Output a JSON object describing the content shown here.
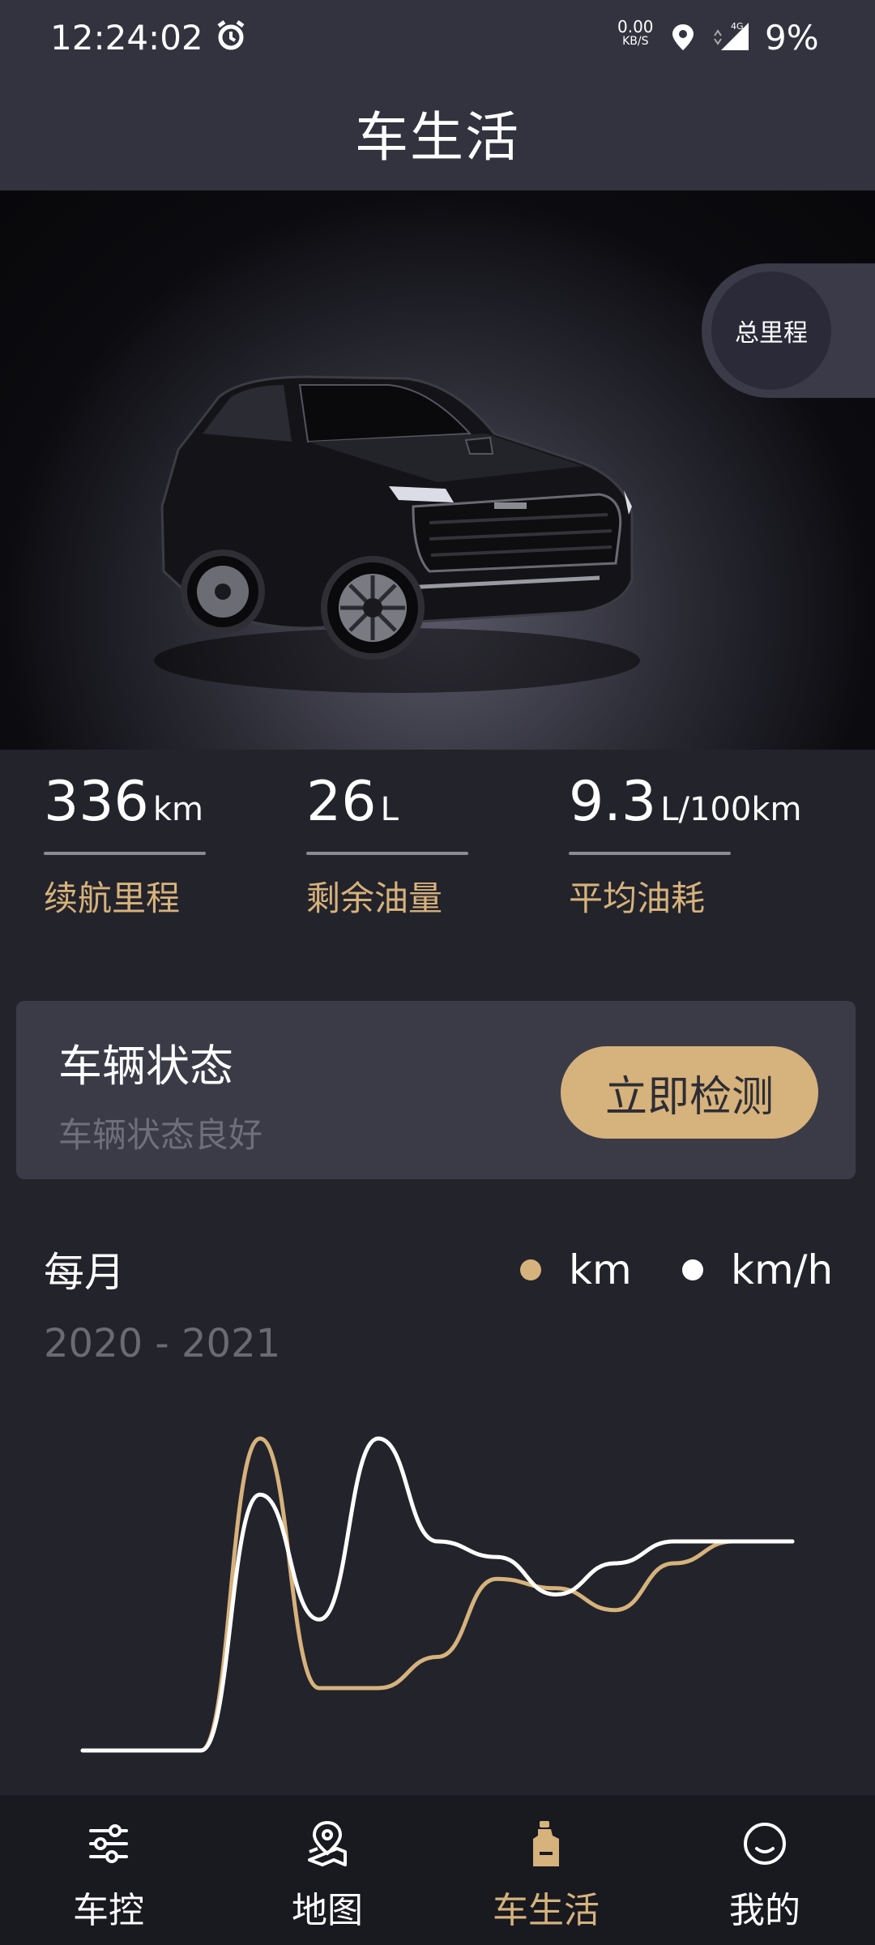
{
  "status_bar": {
    "time": "12:24:02",
    "net_speed": "0.00",
    "net_unit": "KB/S",
    "network_type": "4G",
    "battery": "9%"
  },
  "app_bar": {
    "title": "车生活"
  },
  "hero": {
    "mileage_button_label": "总里程"
  },
  "stats": [
    {
      "value": "336",
      "unit": "km",
      "label": "续航里程"
    },
    {
      "value": "26",
      "unit": "L",
      "label": "剩余油量"
    },
    {
      "value": "9.3",
      "unit": "L/100km",
      "label": "平均油耗"
    }
  ],
  "vehicle_status": {
    "title": "车辆状态",
    "subtitle": "车辆状态良好",
    "button_label": "立即检测"
  },
  "chart_header": {
    "title": "每月",
    "range": "2020 - 2021",
    "legend": [
      {
        "name": "km",
        "color": "#d6b27c"
      },
      {
        "name": "km/h",
        "color": "#ffffff"
      }
    ]
  },
  "chart_data": {
    "type": "line",
    "title": "每月",
    "subtitle": "2020 - 2021",
    "x": [
      0,
      1,
      2,
      3,
      4,
      5,
      6,
      7,
      8,
      9,
      10,
      11,
      12
    ],
    "series": [
      {
        "name": "km",
        "color": "#d6b27c",
        "values": [
          0,
          0,
          0,
          100,
          20,
          20,
          30,
          55,
          52,
          45,
          60,
          67,
          67
        ]
      },
      {
        "name": "km/h",
        "color": "#ffffff",
        "values": [
          0,
          0,
          0,
          82,
          42,
          100,
          67,
          62,
          50,
          60,
          67,
          67,
          67
        ]
      }
    ],
    "ylim": [
      0,
      100
    ],
    "grid": false,
    "legend_position": "top-right"
  },
  "bottom_nav": [
    {
      "label": "车控",
      "icon": "sliders-icon",
      "active": false
    },
    {
      "label": "地图",
      "icon": "map-pin-icon",
      "active": false
    },
    {
      "label": "车生活",
      "icon": "oil-bottle-icon",
      "active": true
    },
    {
      "label": "我的",
      "icon": "smile-icon",
      "active": false
    }
  ],
  "colors": {
    "accent": "#d6b27c",
    "background": "#23232b",
    "bar": "#33333f",
    "card": "#3b3b48",
    "nav": "#191920"
  }
}
